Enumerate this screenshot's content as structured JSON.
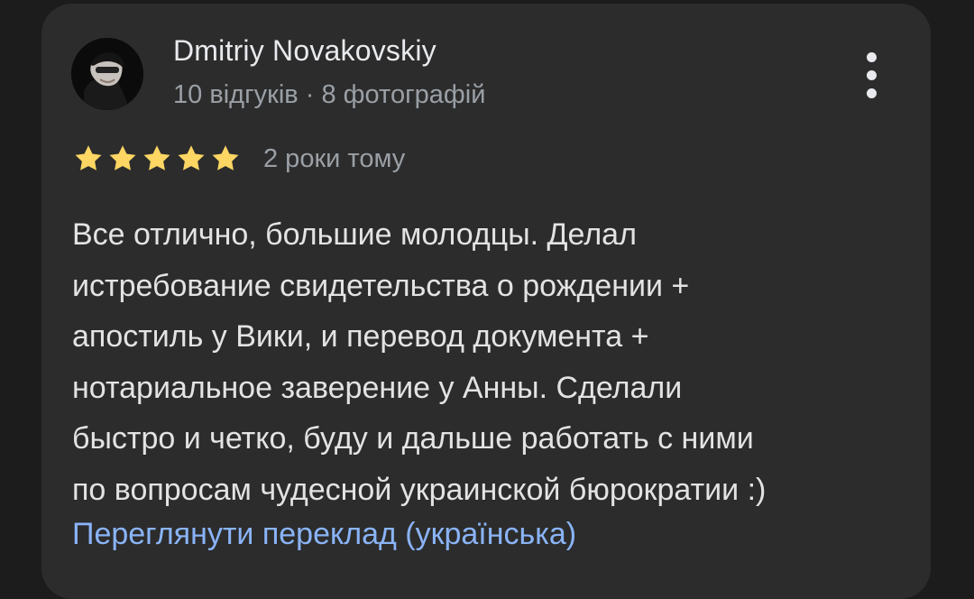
{
  "review": {
    "author_name": "Dmitriy Novakovskiy",
    "author_meta": "10 відгуків · 8 фотографій",
    "rating": 5,
    "rating_max": 5,
    "star_color": "#fdd663",
    "time_ago": "2 роки тому",
    "text_lines": [
      "Все отлично, большие молодцы. Делал",
      "истребование свидетельства о рождении +",
      "апостиль у Вики, и перевод документа +",
      "нотариальное заверение у Анны. Сделали",
      "быстро и четко, буду и дальше работать с ними",
      "по вопросам чудесной украинской бюрократии :)"
    ],
    "translate_link": "Переглянути переклад (українська)",
    "menu_icon": "more-vert-icon",
    "link_color": "#8ab4f8"
  }
}
